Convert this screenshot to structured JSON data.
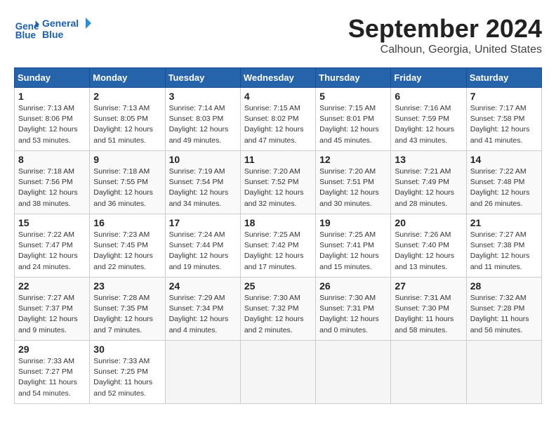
{
  "header": {
    "logo_line1": "General",
    "logo_line2": "Blue",
    "month": "September 2024",
    "location": "Calhoun, Georgia, United States"
  },
  "days_of_week": [
    "Sunday",
    "Monday",
    "Tuesday",
    "Wednesday",
    "Thursday",
    "Friday",
    "Saturday"
  ],
  "weeks": [
    [
      {
        "day": "1",
        "sunrise": "7:13 AM",
        "sunset": "8:06 PM",
        "daylight": "12 hours and 53 minutes."
      },
      {
        "day": "2",
        "sunrise": "7:13 AM",
        "sunset": "8:05 PM",
        "daylight": "12 hours and 51 minutes."
      },
      {
        "day": "3",
        "sunrise": "7:14 AM",
        "sunset": "8:03 PM",
        "daylight": "12 hours and 49 minutes."
      },
      {
        "day": "4",
        "sunrise": "7:15 AM",
        "sunset": "8:02 PM",
        "daylight": "12 hours and 47 minutes."
      },
      {
        "day": "5",
        "sunrise": "7:15 AM",
        "sunset": "8:01 PM",
        "daylight": "12 hours and 45 minutes."
      },
      {
        "day": "6",
        "sunrise": "7:16 AM",
        "sunset": "7:59 PM",
        "daylight": "12 hours and 43 minutes."
      },
      {
        "day": "7",
        "sunrise": "7:17 AM",
        "sunset": "7:58 PM",
        "daylight": "12 hours and 41 minutes."
      }
    ],
    [
      {
        "day": "8",
        "sunrise": "7:18 AM",
        "sunset": "7:56 PM",
        "daylight": "12 hours and 38 minutes."
      },
      {
        "day": "9",
        "sunrise": "7:18 AM",
        "sunset": "7:55 PM",
        "daylight": "12 hours and 36 minutes."
      },
      {
        "day": "10",
        "sunrise": "7:19 AM",
        "sunset": "7:54 PM",
        "daylight": "12 hours and 34 minutes."
      },
      {
        "day": "11",
        "sunrise": "7:20 AM",
        "sunset": "7:52 PM",
        "daylight": "12 hours and 32 minutes."
      },
      {
        "day": "12",
        "sunrise": "7:20 AM",
        "sunset": "7:51 PM",
        "daylight": "12 hours and 30 minutes."
      },
      {
        "day": "13",
        "sunrise": "7:21 AM",
        "sunset": "7:49 PM",
        "daylight": "12 hours and 28 minutes."
      },
      {
        "day": "14",
        "sunrise": "7:22 AM",
        "sunset": "7:48 PM",
        "daylight": "12 hours and 26 minutes."
      }
    ],
    [
      {
        "day": "15",
        "sunrise": "7:22 AM",
        "sunset": "7:47 PM",
        "daylight": "12 hours and 24 minutes."
      },
      {
        "day": "16",
        "sunrise": "7:23 AM",
        "sunset": "7:45 PM",
        "daylight": "12 hours and 22 minutes."
      },
      {
        "day": "17",
        "sunrise": "7:24 AM",
        "sunset": "7:44 PM",
        "daylight": "12 hours and 19 minutes."
      },
      {
        "day": "18",
        "sunrise": "7:25 AM",
        "sunset": "7:42 PM",
        "daylight": "12 hours and 17 minutes."
      },
      {
        "day": "19",
        "sunrise": "7:25 AM",
        "sunset": "7:41 PM",
        "daylight": "12 hours and 15 minutes."
      },
      {
        "day": "20",
        "sunrise": "7:26 AM",
        "sunset": "7:40 PM",
        "daylight": "12 hours and 13 minutes."
      },
      {
        "day": "21",
        "sunrise": "7:27 AM",
        "sunset": "7:38 PM",
        "daylight": "12 hours and 11 minutes."
      }
    ],
    [
      {
        "day": "22",
        "sunrise": "7:27 AM",
        "sunset": "7:37 PM",
        "daylight": "12 hours and 9 minutes."
      },
      {
        "day": "23",
        "sunrise": "7:28 AM",
        "sunset": "7:35 PM",
        "daylight": "12 hours and 7 minutes."
      },
      {
        "day": "24",
        "sunrise": "7:29 AM",
        "sunset": "7:34 PM",
        "daylight": "12 hours and 4 minutes."
      },
      {
        "day": "25",
        "sunrise": "7:30 AM",
        "sunset": "7:32 PM",
        "daylight": "12 hours and 2 minutes."
      },
      {
        "day": "26",
        "sunrise": "7:30 AM",
        "sunset": "7:31 PM",
        "daylight": "12 hours and 0 minutes."
      },
      {
        "day": "27",
        "sunrise": "7:31 AM",
        "sunset": "7:30 PM",
        "daylight": "11 hours and 58 minutes."
      },
      {
        "day": "28",
        "sunrise": "7:32 AM",
        "sunset": "7:28 PM",
        "daylight": "11 hours and 56 minutes."
      }
    ],
    [
      {
        "day": "29",
        "sunrise": "7:33 AM",
        "sunset": "7:27 PM",
        "daylight": "11 hours and 54 minutes."
      },
      {
        "day": "30",
        "sunrise": "7:33 AM",
        "sunset": "7:25 PM",
        "daylight": "11 hours and 52 minutes."
      },
      null,
      null,
      null,
      null,
      null
    ]
  ]
}
